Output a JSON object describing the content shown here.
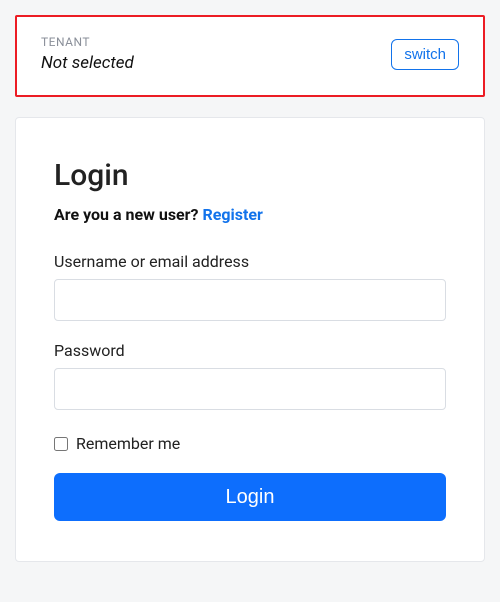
{
  "tenant": {
    "label": "TENANT",
    "value": "Not selected",
    "switch_label": "switch"
  },
  "login": {
    "title": "Login",
    "new_user_text": "Are you a new user? ",
    "register_label": "Register",
    "username_label": "Username or email address",
    "username_value": "",
    "password_label": "Password",
    "password_value": "",
    "remember_label": "Remember me",
    "remember_checked": false,
    "submit_label": "Login"
  }
}
